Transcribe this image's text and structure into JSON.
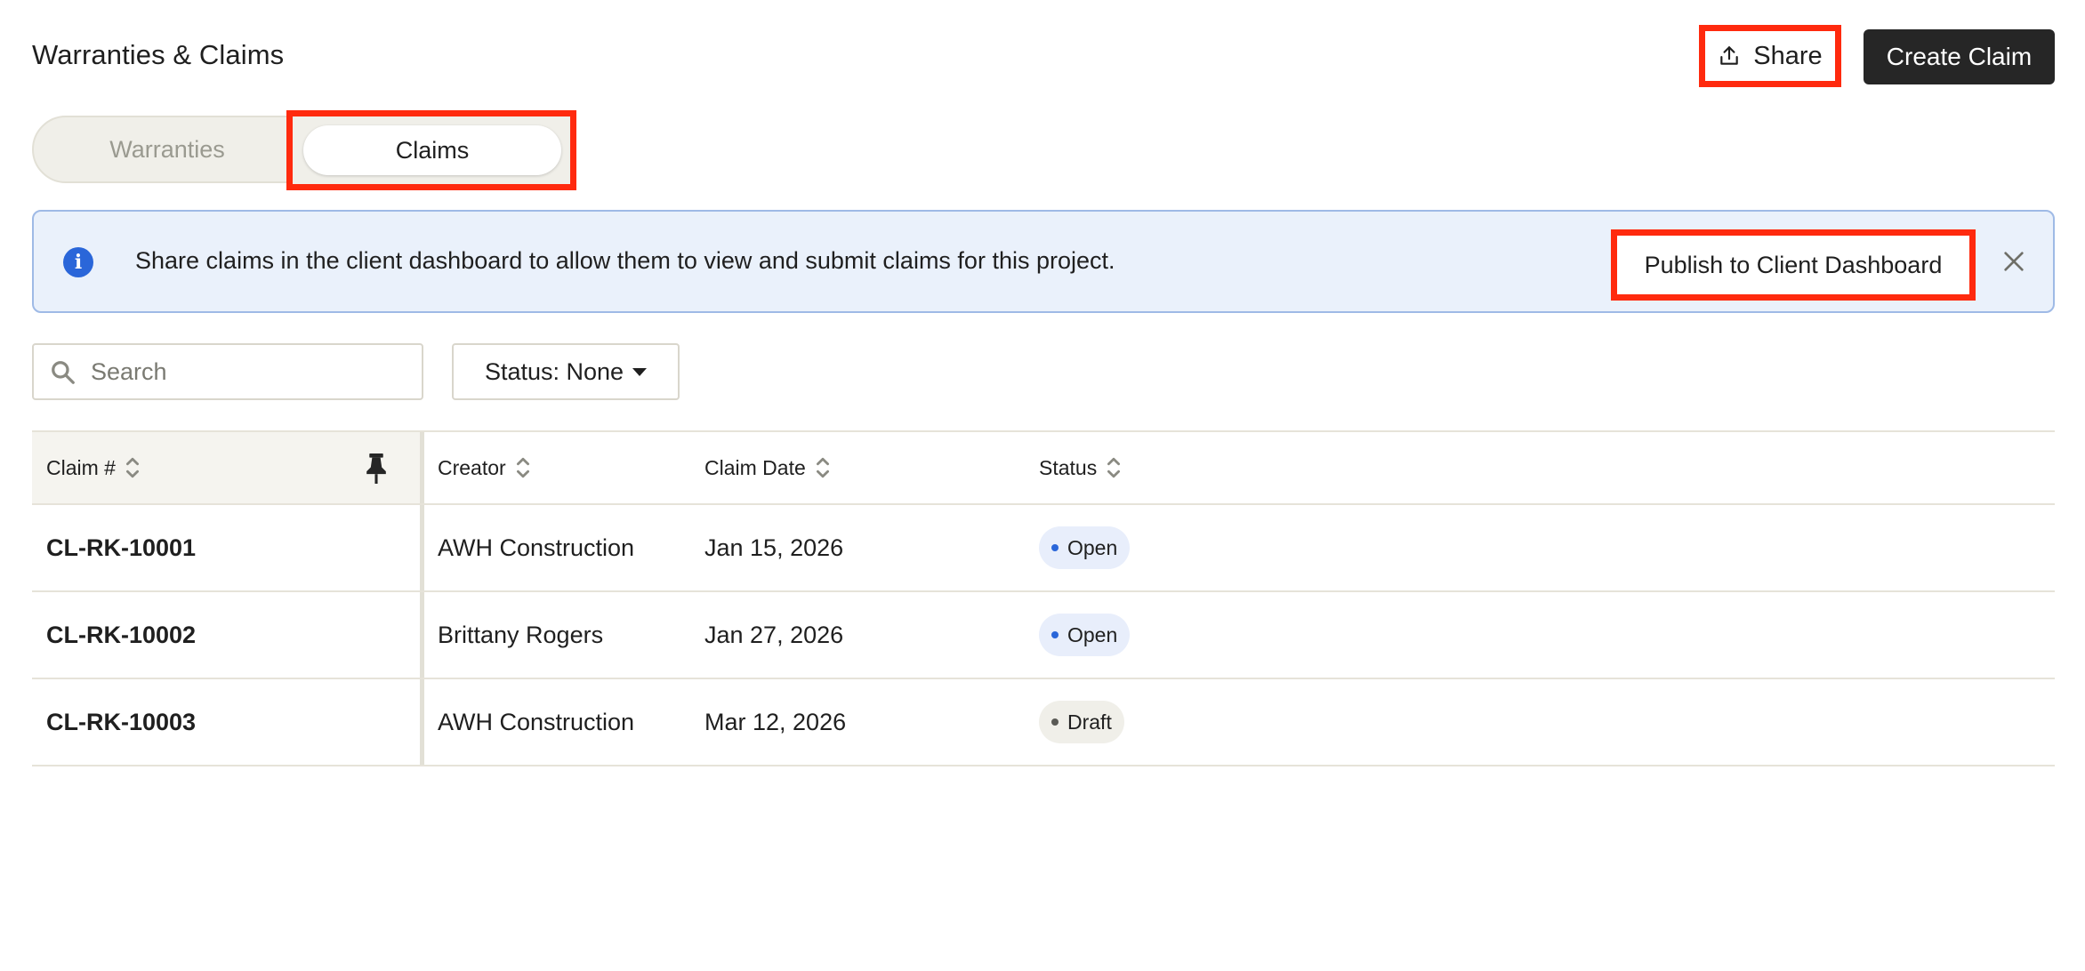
{
  "header": {
    "title": "Warranties & Claims",
    "share_label": "Share",
    "create_label": "Create Claim"
  },
  "tabs": [
    {
      "label": "Warranties",
      "active": false
    },
    {
      "label": "Claims",
      "active": true
    }
  ],
  "banner": {
    "text": "Share claims in the client dashboard to allow them to view and submit claims for this project.",
    "publish_label": "Publish to Client Dashboard"
  },
  "filters": {
    "search_placeholder": "Search",
    "search_value": "",
    "status_label": "Status: None"
  },
  "table": {
    "columns": [
      "Claim #",
      "Creator",
      "Claim Date",
      "Status"
    ],
    "rows": [
      {
        "id": "CL-RK-10001",
        "creator": "AWH Construction",
        "date": "Jan 15, 2026",
        "status": "Open"
      },
      {
        "id": "CL-RK-10002",
        "creator": "Brittany Rogers",
        "date": "Jan 27, 2026",
        "status": "Open"
      },
      {
        "id": "CL-RK-10003",
        "creator": "AWH Construction",
        "date": "Mar 12, 2026",
        "status": "Draft"
      }
    ]
  },
  "colors": {
    "highlight": "#ff2a0e",
    "primary_button": "#262626",
    "banner_bg": "#eaf1fb",
    "info_blue": "#2a66d9",
    "status_open_dot": "#2a66d9",
    "status_draft_dot": "#5a5a55"
  },
  "icons": {
    "share": "share-icon",
    "info": "info-icon",
    "close": "close-icon",
    "search": "search-icon",
    "sort": "sort-icon",
    "pin": "pin-icon",
    "caret": "caret-down-icon"
  }
}
